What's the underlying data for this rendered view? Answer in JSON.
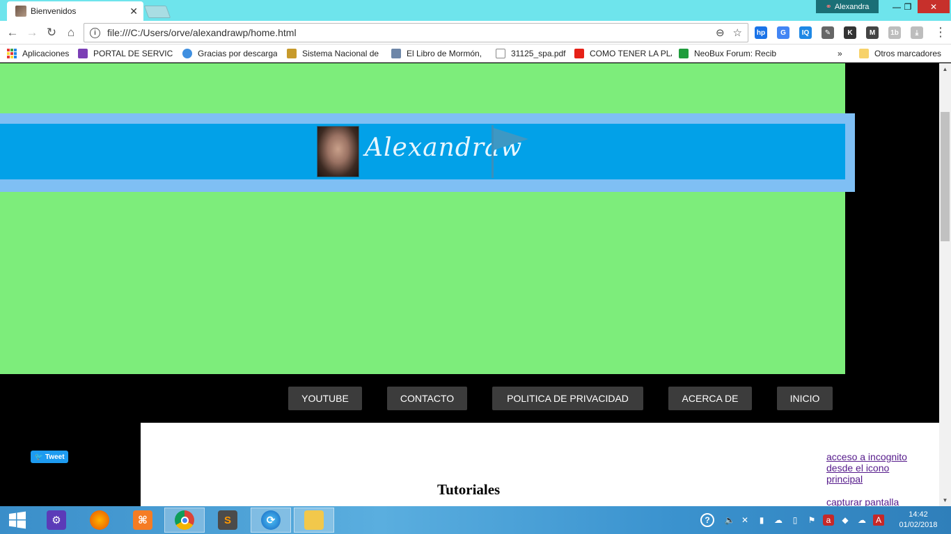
{
  "browser": {
    "tab_title": "Bienvenidos",
    "profile_name": "Alexandra",
    "url": "file:///C:/Users/orve/alexandrawp/home.html",
    "extensions": [
      {
        "name": "hp",
        "label": "hp",
        "color": "#1a73e8"
      },
      {
        "name": "translate",
        "label": "G",
        "color": "#4285f4"
      },
      {
        "name": "iq",
        "label": "IQ",
        "color": "#1e88e5"
      },
      {
        "name": "tools",
        "label": "✎",
        "color": "#666666"
      },
      {
        "name": "k",
        "label": "K",
        "color": "#333333"
      },
      {
        "name": "m",
        "label": "M",
        "color": "#444444"
      },
      {
        "name": "1b",
        "label": "1b",
        "color": "#bdbdbd"
      },
      {
        "name": "pdf",
        "label": "⤓",
        "color": "#bdbdbd"
      }
    ]
  },
  "bookmarks": {
    "items": [
      {
        "label": "Aplicaciones",
        "icon": "apps-grid-icon"
      },
      {
        "label": "PORTAL DE SERVICIO",
        "icon": "list-icon",
        "color": "#7b3fb5"
      },
      {
        "label": "Gracias por descargar",
        "icon": "balloon-icon",
        "color": "#3f8fe0"
      },
      {
        "label": "Sistema Nacional de",
        "icon": "pen-icon",
        "color": "#c79a2b"
      },
      {
        "label": "El Libro de Mormón,",
        "icon": "book-icon",
        "color": "#6d86a8"
      },
      {
        "label": "31125_spa.pdf",
        "icon": "file-icon",
        "color": "#ffffff"
      },
      {
        "label": "COMO TENER LA PLA",
        "icon": "youtube-icon",
        "color": "#e62117"
      },
      {
        "label": "NeoBux Forum: Recib",
        "icon": "x-icon",
        "color": "#1f9c3c"
      }
    ],
    "overflow": "»",
    "other": "Otros marcadores"
  },
  "page": {
    "logo_text": "Alexandraw",
    "nav": [
      "YOUTUBE",
      "CONTACTO",
      "POLITICA DE PRIVACIDAD",
      "ACERCA DE",
      "INICIO"
    ],
    "tweet_label": "Tweet",
    "section_title": "Tutoriales",
    "side_links": [
      "acceso a incognito desde el icono principal",
      "capturar pantalla"
    ]
  },
  "taskbar": {
    "apps": [
      "settings",
      "firefox",
      "xampp",
      "chrome",
      "sublime-text",
      "sync",
      "file-explorer"
    ],
    "time": "14:42",
    "date": "01/02/2018"
  }
}
